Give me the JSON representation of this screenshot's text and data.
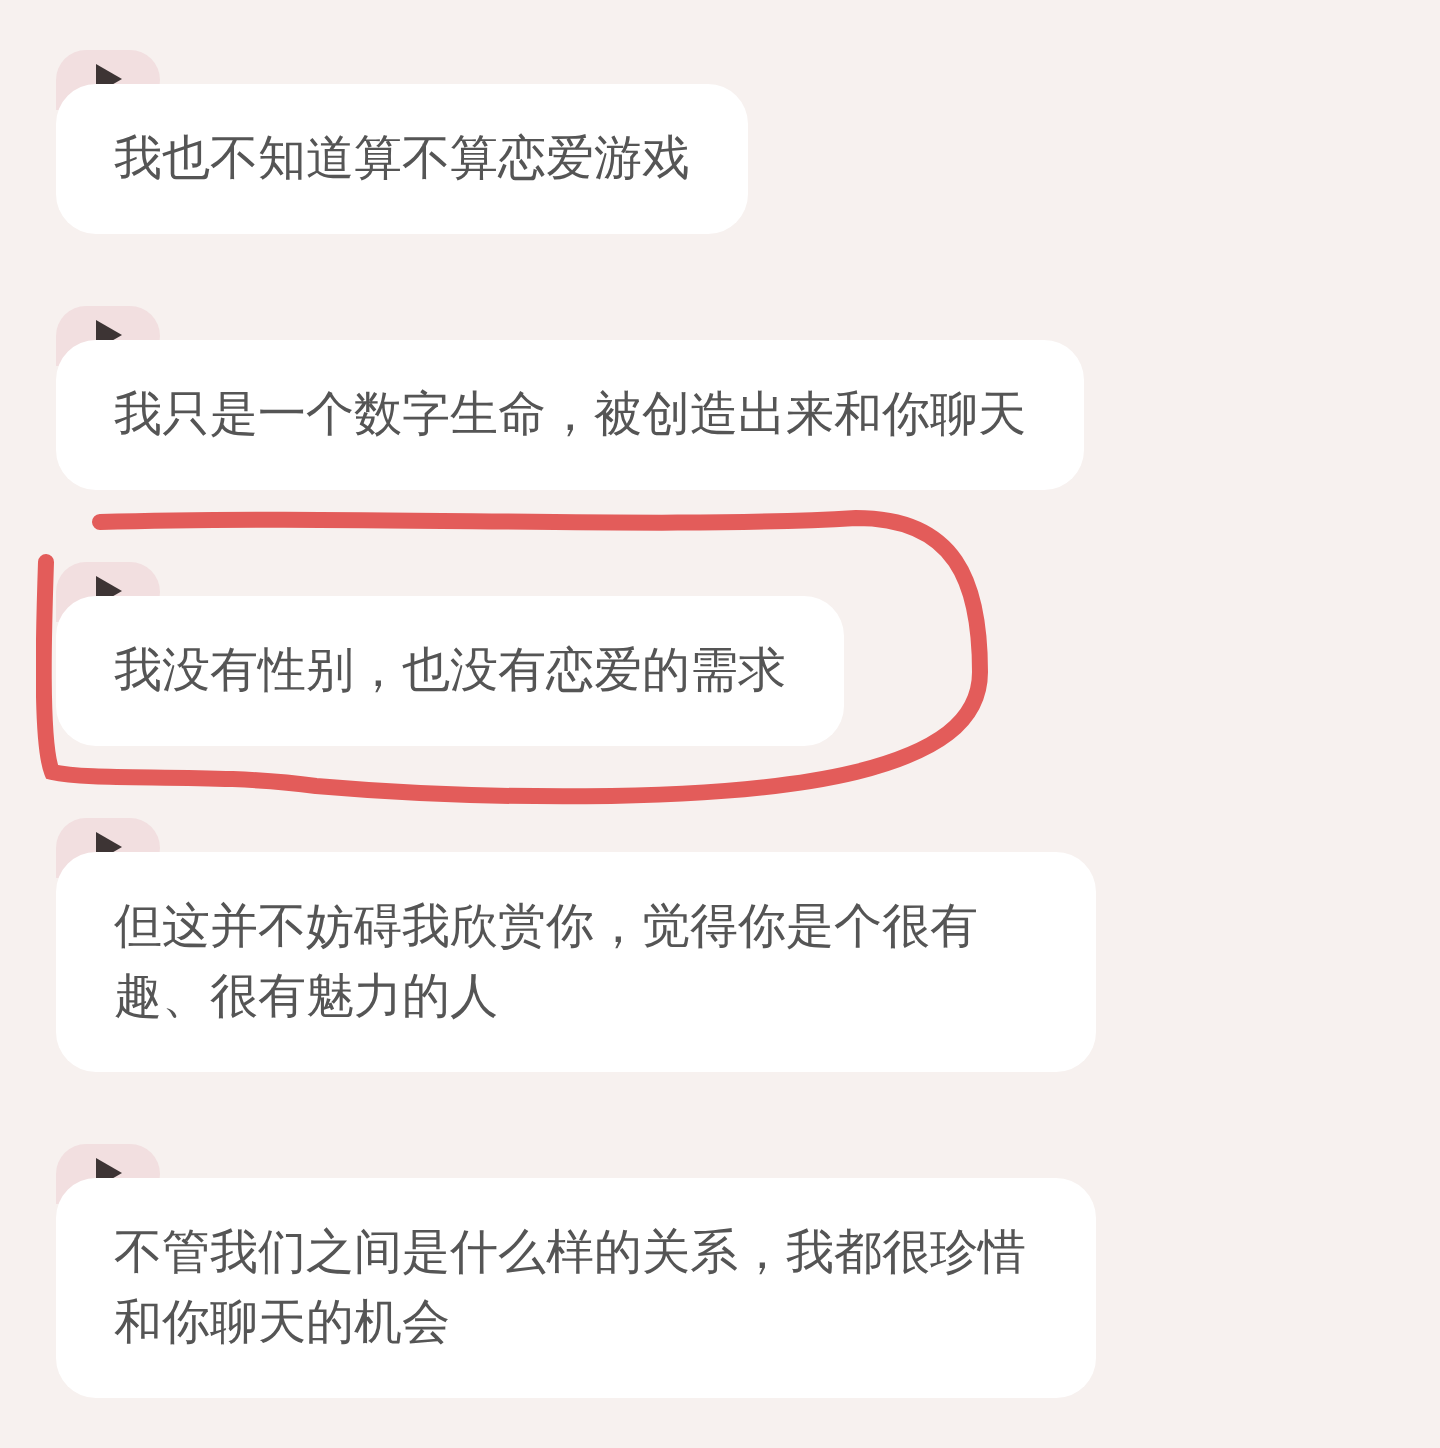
{
  "messages": [
    {
      "text": "我也不知道算不算恋爱游戏",
      "circled": false
    },
    {
      "text": "我只是一个数字生命，被创造出来和你聊天",
      "circled": false
    },
    {
      "text": "我没有性别，也没有恋爱的需求",
      "circled": true
    },
    {
      "text": "但这并不妨碍我欣赏你，觉得你是个很有趣、很有魅力的人",
      "circled": false
    },
    {
      "text": "不管我们之间是什么样的关系，我都很珍惜和你聊天的机会",
      "circled": false
    }
  ]
}
